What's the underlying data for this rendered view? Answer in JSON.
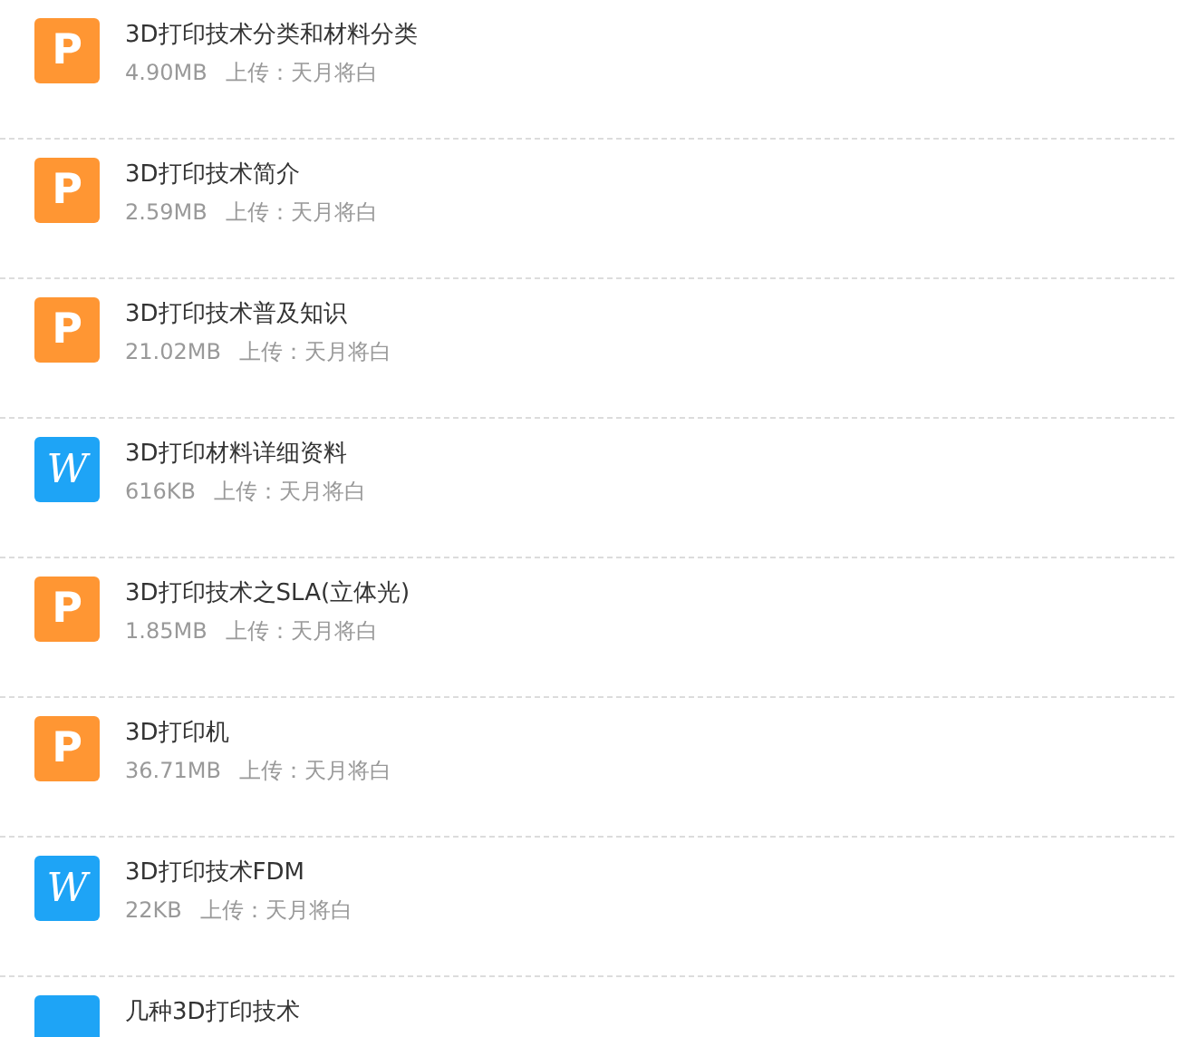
{
  "files": [
    {
      "kind": "ppt",
      "badge": "P",
      "title": "3D打印技术分类和材料分类",
      "size": "4.90MB",
      "uploader": "上传：天月将白"
    },
    {
      "kind": "ppt",
      "badge": "P",
      "title": "3D打印技术简介",
      "size": "2.59MB",
      "uploader": "上传：天月将白"
    },
    {
      "kind": "ppt",
      "badge": "P",
      "title": "3D打印技术普及知识",
      "size": "21.02MB",
      "uploader": "上传：天月将白"
    },
    {
      "kind": "word",
      "badge": "W",
      "title": "3D打印材料详细资料",
      "size": "616KB",
      "uploader": "上传：天月将白"
    },
    {
      "kind": "ppt",
      "badge": "P",
      "title": "3D打印技术之SLA(立体光)",
      "size": "1.85MB",
      "uploader": "上传：天月将白"
    },
    {
      "kind": "ppt",
      "badge": "P",
      "title": "3D打印机",
      "size": "36.71MB",
      "uploader": "上传：天月将白"
    },
    {
      "kind": "word",
      "badge": "W",
      "title": "3D打印技术FDM",
      "size": "22KB",
      "uploader": "上传：天月将白"
    },
    {
      "kind": "word",
      "title": "几种3D打印技术"
    }
  ]
}
